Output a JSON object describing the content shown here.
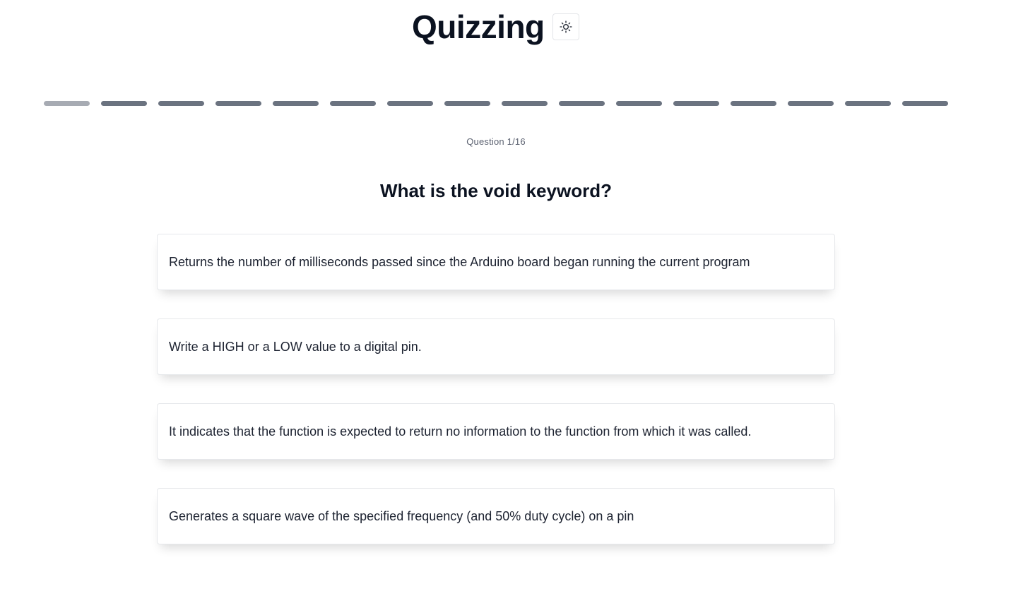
{
  "app": {
    "title": "Quizzing",
    "theme_toggle_icon": "sun-icon"
  },
  "progress": {
    "current": 1,
    "total": 16,
    "colors": {
      "current": "#a7abb3",
      "remaining": "#6b7380"
    }
  },
  "question": {
    "counter": "Question 1/16",
    "text": "What is the void keyword?"
  },
  "answers": [
    {
      "label": "Returns the number of milliseconds passed since the Arduino board began running the current program"
    },
    {
      "label": "Write a HIGH or a LOW value to a digital pin."
    },
    {
      "label": "It indicates that the function is expected to return no information to the function from which it was called."
    },
    {
      "label": "Generates a square wave of the specified frequency (and 50% duty cycle) on a pin"
    }
  ]
}
